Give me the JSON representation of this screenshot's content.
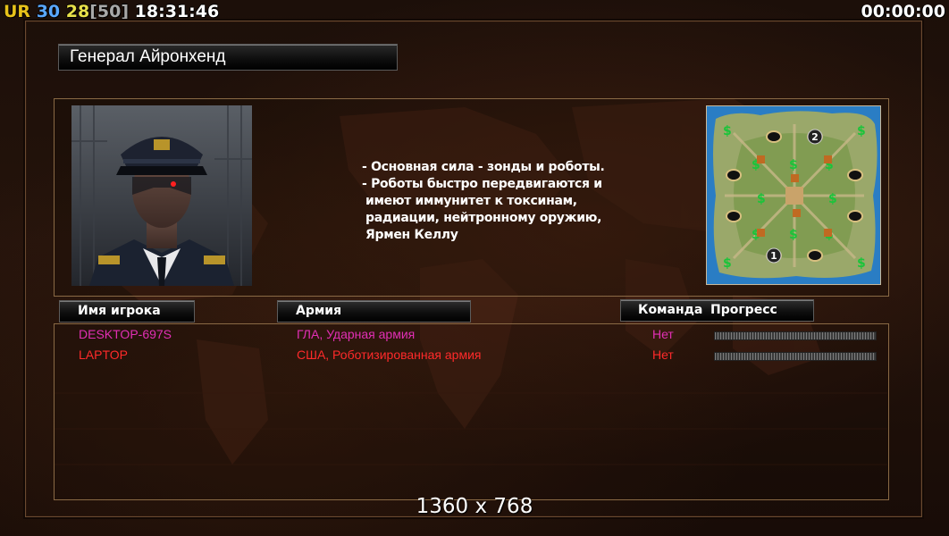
{
  "hud": {
    "ur_label": "UR",
    "fps1": "30",
    "fps2": "28",
    "fps_cap": "[50]",
    "clock": "18:31:46",
    "timer": "00:00:00",
    "colors": {
      "ur": "#e8c21a",
      "fps1": "#5aa8ff",
      "fps2": "#e8e04a",
      "cap": "#a8a8a8"
    }
  },
  "general": {
    "name": "Генерал Айронхенд",
    "description": [
      "- Основная сила - зонды и роботы.",
      "- Роботы быстро передвигаются и",
      "  имеют иммунитет к токсинам,",
      "  радиации, нейтронному оружию,",
      "  Ярмен Келлу"
    ]
  },
  "minimap": {
    "start_positions": [
      "1",
      "2"
    ]
  },
  "table": {
    "headers": {
      "player": "Имя игрока",
      "army": "Армия",
      "team": "Команда",
      "progress": "Прогресс"
    },
    "rows": [
      {
        "player": "DESKTOP-697S",
        "army": "ГЛА, Ударная армия",
        "team": "Нет",
        "color": "#e22fb5"
      },
      {
        "player": "LAPTOP",
        "army": "США, Роботизированная армия",
        "team": "Нет",
        "color": "#ff2a2a"
      }
    ]
  },
  "resolution": "1360 x 768"
}
